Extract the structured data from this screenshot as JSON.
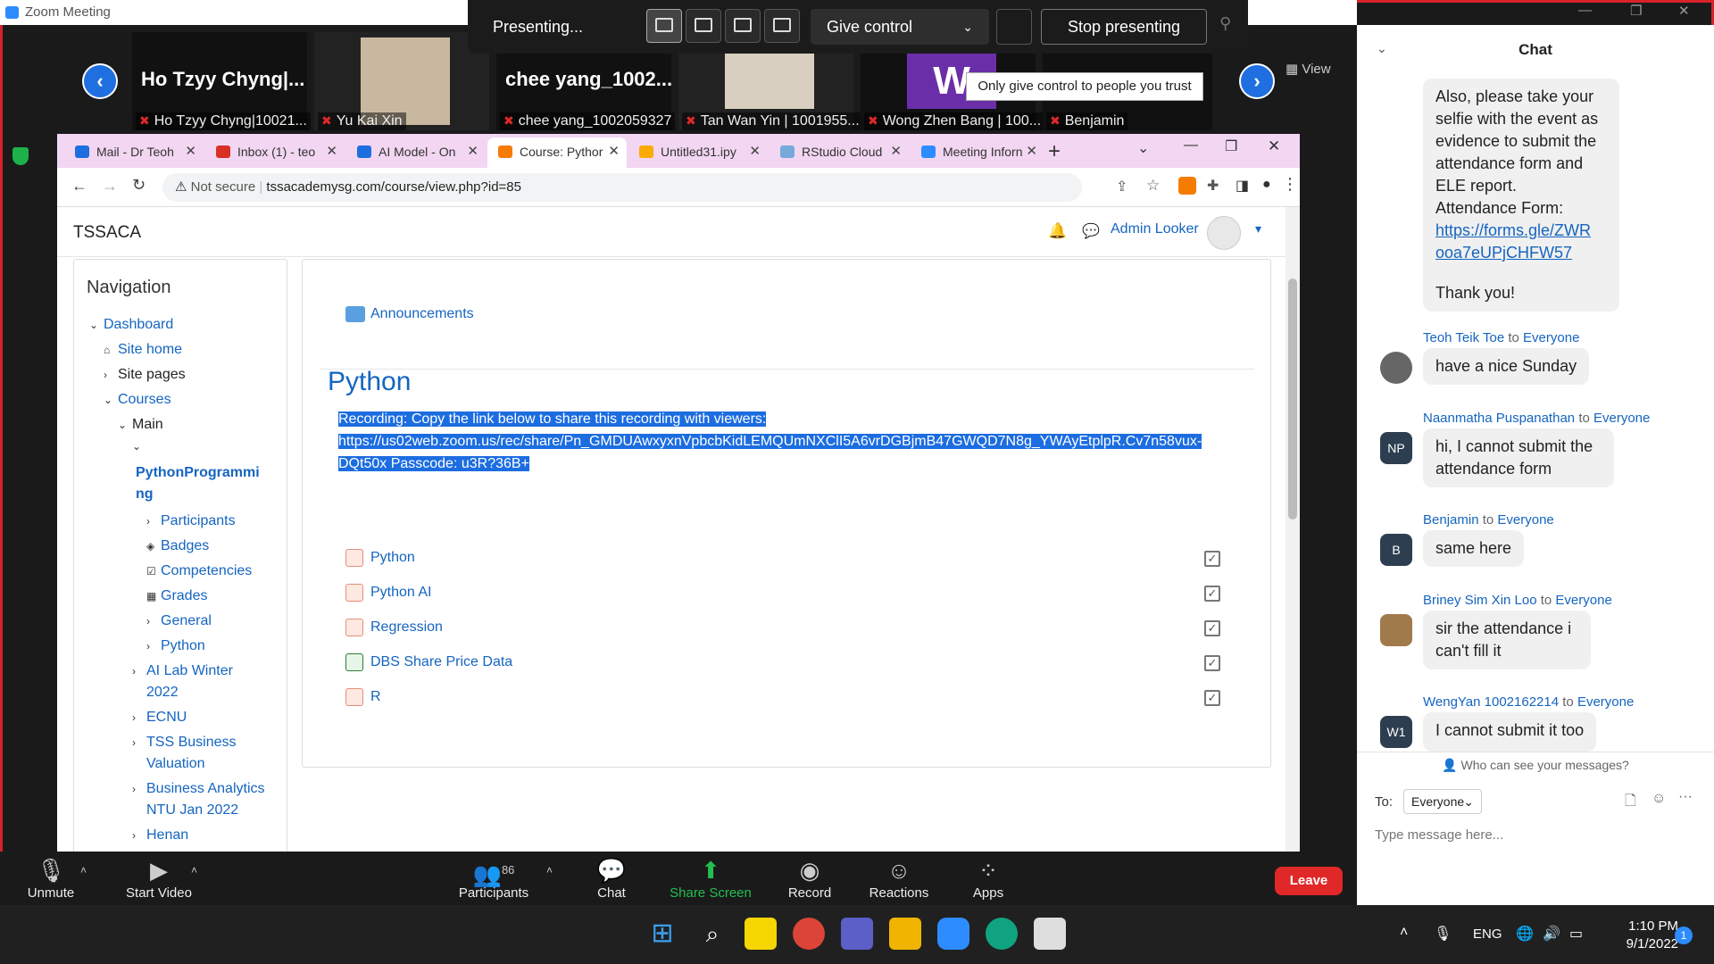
{
  "zoom": {
    "title": "Zoom Meeting",
    "presenting_label": "Presenting...",
    "give_control_label": "Give control",
    "stop_presenting_label": "Stop presenting",
    "view_label": "View",
    "tooltip": "Only give control to people you trust"
  },
  "tiles": [
    {
      "name": "Ho Tzyy Chyng|...",
      "label": "Ho Tzyy Chyng|10021..."
    },
    {
      "name": "",
      "label": "Yu Kai Xin"
    },
    {
      "name": "chee yang_1002...",
      "label": "chee yang_1002059327"
    },
    {
      "name": "",
      "label": "Tan Wan Yin | 1001955..."
    },
    {
      "name": "W",
      "label": "Wong Zhen Bang | 100..."
    },
    {
      "name": "",
      "label": "Benjamin"
    }
  ],
  "browser": {
    "tabs": [
      {
        "label": "Mail - Dr Teoh",
        "color": "#1d6fe0"
      },
      {
        "label": "Inbox (1) - teo",
        "color": "#d93025"
      },
      {
        "label": "AI Model - On",
        "color": "#1d6fe0"
      },
      {
        "label": "Course: Pythor",
        "color": "#f57c00"
      },
      {
        "label": "Untitled31.ipy",
        "color": "#f9ab00"
      },
      {
        "label": "RStudio Cloud",
        "color": "#75aadb"
      },
      {
        "label": "Meeting Inforn",
        "color": "#2d8cff"
      }
    ],
    "not_secure": "Not secure",
    "url": "tssacademysg.com/course/view.php?id=85"
  },
  "page": {
    "site_name": "TSSACA",
    "user_name": "Admin Looker",
    "nav_title": "Navigation",
    "nav_items": [
      "Dashboard",
      "Site home",
      "Site pages",
      "Courses",
      "Main",
      "PythonProgrammi",
      "ng",
      "Participants",
      "Badges",
      "Competencies",
      "Grades",
      "General",
      "Python",
      "AI Lab Winter",
      "2022",
      "ECNU",
      "TSS Business",
      "Valuation",
      "Business Analytics",
      "NTU Jan 2022",
      "Henan"
    ],
    "announcements": "Announcements",
    "section_title": "Python",
    "selected_text_1": "Recording: Copy the link below to share this recording with viewers:",
    "selected_text_2": "https://us02web.zoom.us/rec/share/Pn_GMDUAwxyxnVpbcbKidLEMQUmNXClI5A6vrDGBjmB47GWQD7N8g_YWAyEtplpR.Cv7n58vux-",
    "selected_text_3": "DQt50x Passcode: u3R?36B+",
    "activities": [
      "Python",
      "Python AI",
      "Regression",
      "DBS Share Price Data",
      "R"
    ]
  },
  "chat": {
    "title": "Chat",
    "first_msg": [
      "Also, please take your",
      "selfie with the event as",
      "evidence to submit the",
      "attendance form and",
      "ELE report.",
      "Attendance Form:"
    ],
    "first_link": [
      "https://forms.gle/ZWR",
      "ooa7eUPjCHFW57"
    ],
    "first_thanks": "Thank you!",
    "messages": [
      {
        "sender": "Teoh Teik Toe",
        "to": "to",
        "target": "Everyone",
        "text": "have a nice Sunday",
        "avatar": ""
      },
      {
        "sender": "Naanmatha Puspanathan",
        "to": "to",
        "target": "Everyone",
        "text": "hi, I cannot submit the attendance form",
        "avatar": "NP"
      },
      {
        "sender": "Benjamin",
        "to": "to",
        "target": "Everyone",
        "text": "same here",
        "avatar": "B"
      },
      {
        "sender": "Briney Sim Xin Loo",
        "to": "to",
        "target": "Everyone",
        "text": "sir the attendance i can't fill it",
        "avatar": ""
      },
      {
        "sender": "WengYan 1002162214",
        "to": "to",
        "target": "Everyone",
        "text": "I cannot submit it too",
        "avatar": "W1"
      }
    ],
    "who_can_see": "Who can see your messages?",
    "to_label": "To:",
    "to_value": "Everyone",
    "input_placeholder": "Type message here..."
  },
  "toolbar": {
    "unmute": "Unmute",
    "start_video": "Start Video",
    "participants": "Participants",
    "participants_count": "86",
    "chat": "Chat",
    "share_screen": "Share Screen",
    "record": "Record",
    "reactions": "Reactions",
    "apps": "Apps",
    "leave": "Leave"
  },
  "taskbar": {
    "lang": "ENG",
    "time": "1:10 PM",
    "date": "9/1/2022",
    "notif": "1"
  }
}
